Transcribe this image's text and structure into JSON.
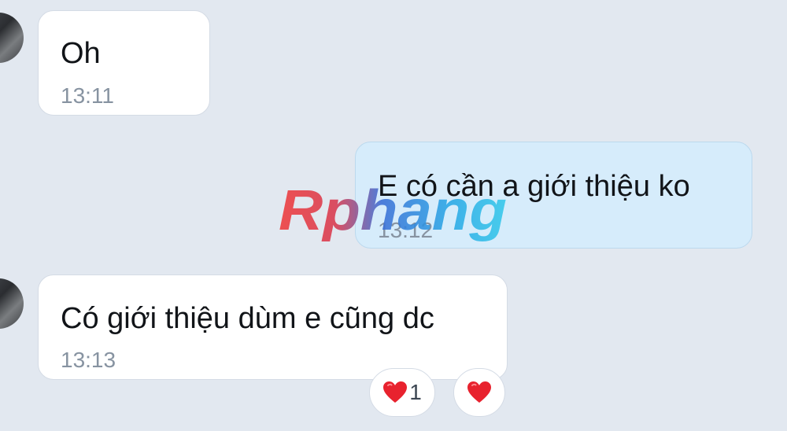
{
  "messages": [
    {
      "direction": "incoming",
      "text": "Oh",
      "time": "13:11"
    },
    {
      "direction": "outgoing",
      "text": "E có cần a giới thiệu ko",
      "time": "13:12"
    },
    {
      "direction": "incoming",
      "text": "Có giới thiệu dùm e cũng dc",
      "time": "13:13"
    }
  ],
  "reactions": {
    "count_badge": {
      "icon": "heart-icon",
      "count": "1"
    },
    "add_button": {
      "icon": "heart-icon"
    }
  },
  "watermark": {
    "text": "Rphang"
  },
  "colors": {
    "background": "#e2e8f0",
    "incoming_bubble": "#ffffff",
    "outgoing_bubble": "#d6ecfb",
    "heart": "#e8222e",
    "timestamp": "#8793a1"
  }
}
